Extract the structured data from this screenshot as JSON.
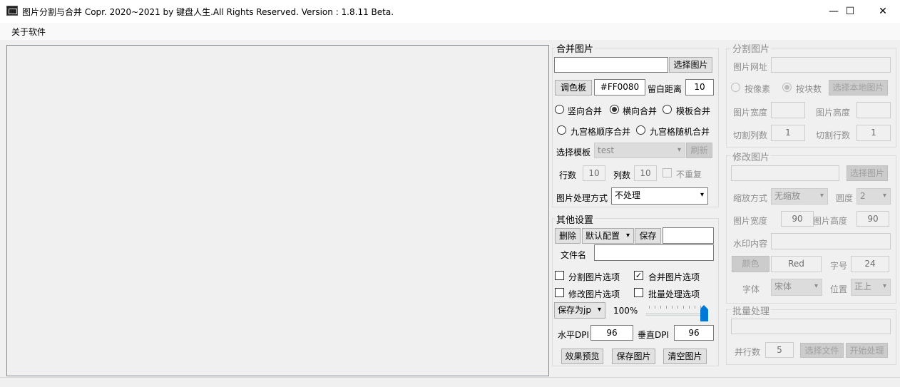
{
  "window": {
    "title": "图片分割与合并    Copr. 2020~2021 by 键盘人生.All Rights Reserved.  Version : 1.8.11 Beta.",
    "minimize": "—",
    "maximize": "☐",
    "close": "✕"
  },
  "menu": {
    "about": "关于软件"
  },
  "merge": {
    "title": "合并图片",
    "path_value": "",
    "select_btn": "选择图片",
    "palette_btn": "调色板",
    "color_value": "#FF0080",
    "margin_label": "留白距离",
    "margin_value": "10",
    "radio_vertical": "竖向合并",
    "radio_horizontal": "横向合并",
    "radio_template": "模板合并",
    "radio_grid_seq": "九宫格顺序合并",
    "radio_grid_rand": "九宫格随机合并",
    "template_label": "选择模板",
    "template_value": "test",
    "refresh_btn": "刷新",
    "rows_label": "行数",
    "rows_value": "10",
    "cols_label": "列数",
    "cols_value": "10",
    "no_repeat": "不重复",
    "process_label": "图片处理方式",
    "process_value": "不处理"
  },
  "other": {
    "title": "其他设置",
    "delete_btn": "删除",
    "config_value": "默认配置",
    "save_btn": "保存",
    "config_name_value": "",
    "filename_label": "文件名",
    "filename_value": "",
    "opt_split": "分割图片选项",
    "opt_merge": "合并图片选项",
    "opt_modify": "修改图片选项",
    "opt_batch": "批量处理选项",
    "format_value": "保存为jp",
    "quality_text": "100%",
    "quality_value": 100,
    "hdpi_label": "水平DPI",
    "hdpi_value": "96",
    "vdpi_label": "垂直DPI",
    "vdpi_value": "96",
    "preview_btn": "效果预览",
    "save_image_btn": "保存图片",
    "clear_btn": "清空图片"
  },
  "split": {
    "title": "分割图片",
    "url_label": "图片网址",
    "url_value": "",
    "radio_pixel": "按像素",
    "radio_block": "按块数",
    "select_local_btn": "选择本地图片",
    "width_label": "图片宽度",
    "width_value": "",
    "height_label": "图片高度",
    "height_value": "",
    "cols_label": "切割列数",
    "cols_value": "1",
    "rows_label": "切割行数",
    "rows_value": "1"
  },
  "modify": {
    "title": "修改图片",
    "path_value": "",
    "select_btn": "选择图片",
    "scale_label": "缩放方式",
    "scale_value": "无缩放",
    "round_label": "圆度",
    "round_value": "2",
    "width_label": "图片宽度",
    "width_value": "90",
    "height_label": "图片高度",
    "height_value": "90",
    "watermark_label": "水印内容",
    "watermark_value": "",
    "color_btn": "颜色",
    "color_value": "Red",
    "fontsize_label": "字号",
    "fontsize_value": "24",
    "font_label": "字体",
    "font_value": "宋体",
    "position_label": "位置",
    "position_value": "正上"
  },
  "batch": {
    "title": "批量处理",
    "path_value": "",
    "parallel_label": "并行数",
    "parallel_value": "5",
    "select_files_btn": "选择文件",
    "start_btn": "开始处理"
  },
  "colors": {
    "accent": "#0078d7",
    "background": "#f0f0f0"
  }
}
